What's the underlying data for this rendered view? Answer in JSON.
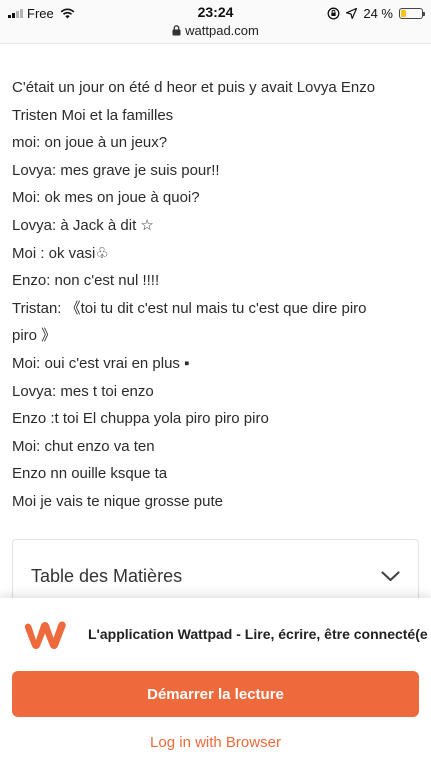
{
  "status_bar": {
    "carrier": "Free",
    "time": "23:24",
    "url": "wattpad.com",
    "battery_text": "24 %",
    "battery_level": 0.24,
    "icons": [
      "signal-icon",
      "wifi-icon",
      "lock-icon",
      "orientation-lock-icon",
      "location-arrow-icon",
      "battery-icon"
    ]
  },
  "story": {
    "lines": [
      "C'était un jour on été d heor et puis y avait Lovya Enzo",
      "Tristen Moi et la familles",
      "moi: on joue à un jeux?",
      "Lovya: mes grave je suis pour!!",
      "Moi: ok mes on joue à quoi?",
      "Lovya: à Jack à dit ☆",
      "Moi : ok vasi♧",
      "Enzo: non c'est nul !!!!",
      "Tristan: 《toi tu dit c'est nul mais tu c'est que dire piro",
      "piro 》",
      "Moi: oui c'est vrai en plus ▪",
      "Lovya: mes t toi enzo",
      "Enzo :t toi El chuppa yola piro piro piro",
      "Moi: chut enzo va ten",
      "Enzo nn ouille ksque ta",
      "Moi je vais te nique grosse pute"
    ]
  },
  "toc": {
    "title": "Table des Matières",
    "icon": "chevron-down-icon"
  },
  "app_banner": {
    "app_name": "L'application Wattpad - Lire, écrire, être connecté(e",
    "start_button": "Démarrer la lecture",
    "browser_link": "Log in with Browser",
    "logo_icon": "wattpad-logo-icon"
  },
  "colors": {
    "accent": "#ee6a3d",
    "text": "#2b2b2b",
    "battery": "#f5c518"
  }
}
